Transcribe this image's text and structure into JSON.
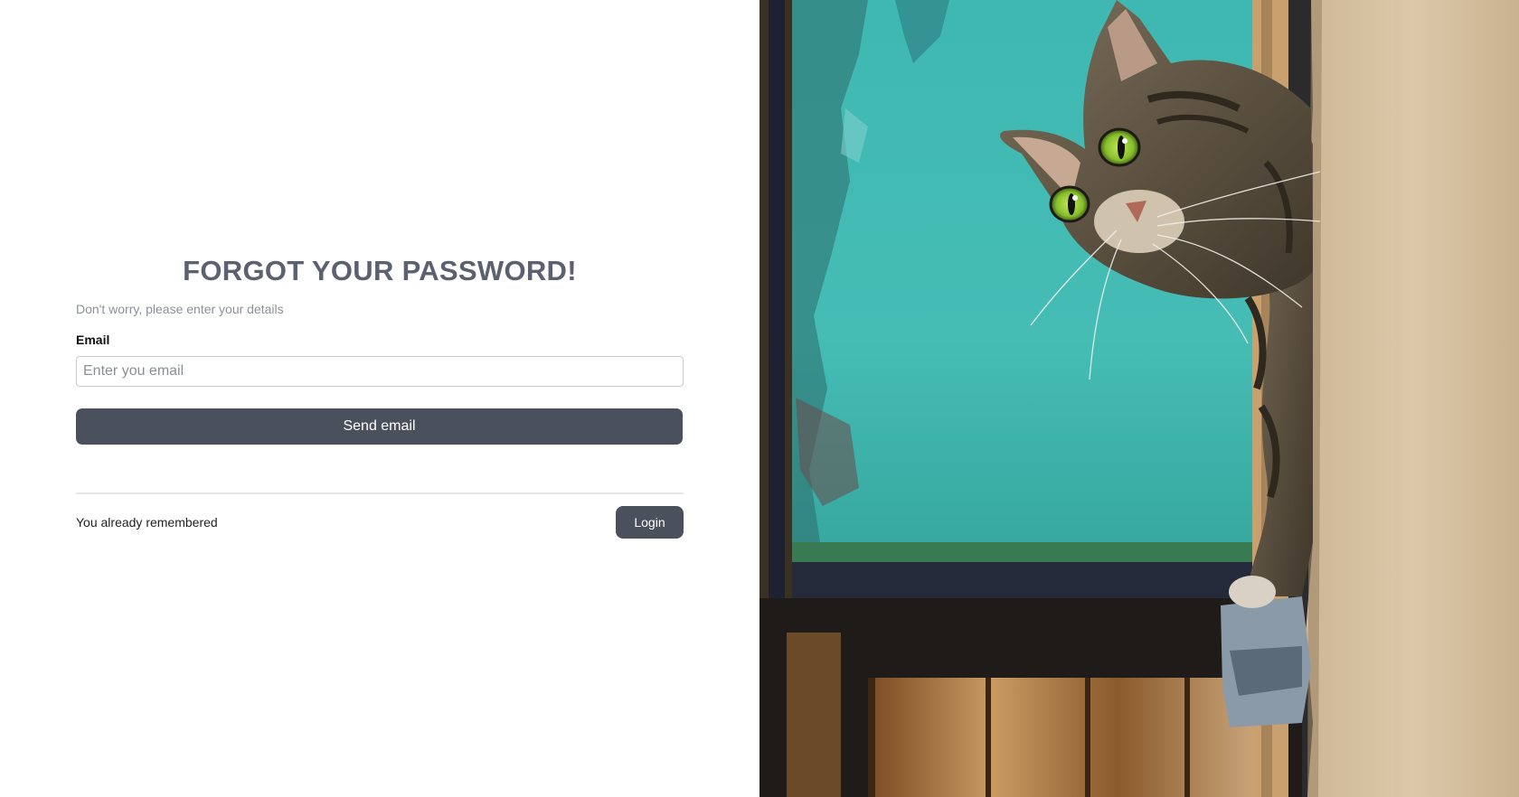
{
  "form": {
    "title": "FORGOT YOUR PASSWORD!",
    "subtitle": "Don't worry, please enter your details",
    "email_label": "Email",
    "email_placeholder": "Enter you email",
    "email_value": "",
    "send_button_label": "Send email",
    "footer_text": "You already remembered",
    "login_button_label": "Login"
  },
  "hero_image": {
    "icon": "cat-photo",
    "colors": {
      "teal_panel": "#3fb5b0",
      "wall": "#d8c4a4",
      "frame": "#2b2f3a",
      "fur": "#6a5e4c",
      "eyes": "#8cc43a"
    }
  },
  "colors": {
    "title": "#5b6170",
    "subtitle": "#8c909a",
    "button_bg": "#4b515c",
    "button_text": "#ffffff",
    "input_border": "#c8ccd2"
  }
}
